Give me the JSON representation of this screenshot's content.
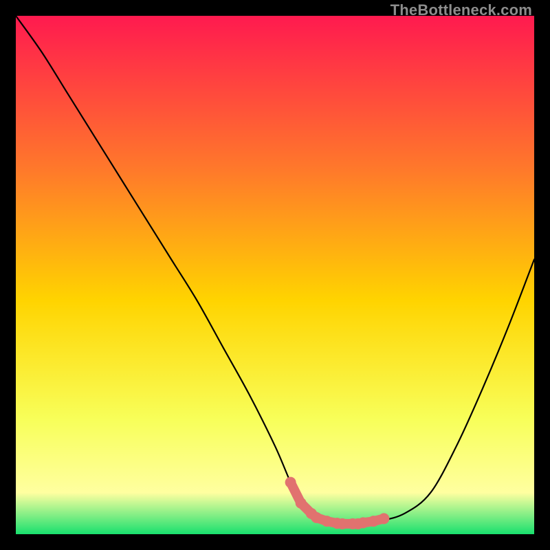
{
  "watermark": "TheBottleneck.com",
  "colors": {
    "gradient_top": "#ff1a4f",
    "gradient_upper_mid": "#ff7a2a",
    "gradient_mid": "#ffd400",
    "gradient_lower_mid": "#f8ff5a",
    "gradient_low": "#ffffa0",
    "gradient_bottom": "#18e06e",
    "curve": "#000000",
    "marker": "#e1726f",
    "frame": "#000000"
  },
  "chart_data": {
    "type": "line",
    "title": "",
    "xlabel": "",
    "ylabel": "",
    "xlim": [
      0,
      100
    ],
    "ylim": [
      0,
      100
    ],
    "series": [
      {
        "name": "bottleneck-curve",
        "x": [
          0,
          5,
          10,
          15,
          20,
          25,
          30,
          35,
          40,
          45,
          50,
          53,
          55,
          57,
          60,
          63,
          66,
          70,
          75,
          80,
          85,
          90,
          95,
          100
        ],
        "values": [
          100,
          93,
          85,
          77,
          69,
          61,
          53,
          45,
          36,
          27,
          17,
          10,
          6,
          4,
          2.5,
          2,
          2,
          2.5,
          4,
          8,
          17,
          28,
          40,
          53
        ]
      }
    ],
    "markers": {
      "name": "highlighted-points",
      "x": [
        53,
        55,
        57,
        58,
        60,
        62,
        63,
        65,
        66,
        67,
        69,
        71
      ],
      "values": [
        10,
        6,
        4,
        3.2,
        2.5,
        2.1,
        2,
        2,
        2,
        2.2,
        2.5,
        3
      ]
    }
  }
}
